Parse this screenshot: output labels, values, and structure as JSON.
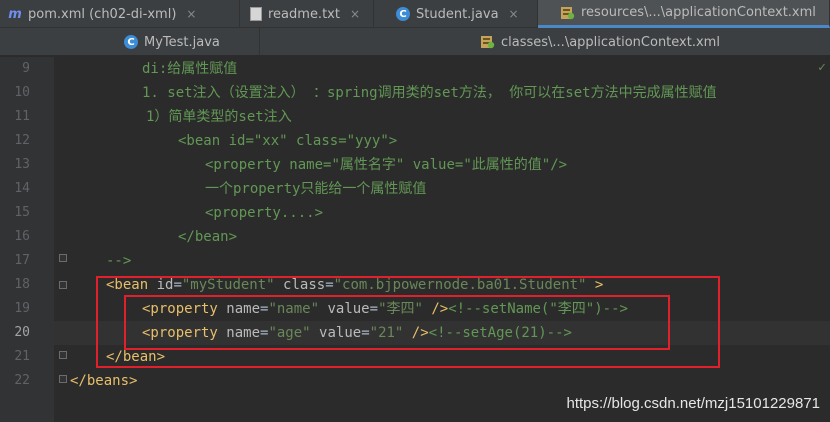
{
  "tabs_row1": [
    {
      "label": "pom.xml (ch02-di-xml)",
      "icon": "maven-icon"
    },
    {
      "label": "readme.txt",
      "icon": "text-file-icon"
    },
    {
      "label": "Student.java",
      "icon": "java-class-icon"
    },
    {
      "label": "resources\\...\\applicationContext.xml",
      "icon": "spring-xml-icon",
      "active": true
    }
  ],
  "tabs_row2": [
    {
      "label": "MyTest.java",
      "icon": "java-class-icon"
    },
    {
      "label": "classes\\...\\applicationContext.xml",
      "icon": "spring-xml-icon"
    }
  ],
  "close_glyph": "×",
  "line_numbers": [
    "9",
    "10",
    "11",
    "12",
    "13",
    "14",
    "15",
    "16",
    "17",
    "18",
    "19",
    "20",
    "21",
    "22"
  ],
  "current_line": "20",
  "lines": {
    "l9": {
      "text": "di:给属性赋值"
    },
    "l10": {
      "text": "1. set注入（设置注入） ：spring调用类的set方法， 你可以在set方法中完成属性赋值"
    },
    "l11": {
      "text": "1）简单类型的set注入"
    },
    "l12": {
      "t1": "<bean ",
      "a1": "id",
      "e1": "=",
      "v1": "\"xx\"",
      "s1": " ",
      "a2": "class",
      "e2": "=",
      "v2": "\"yyy\"",
      "t2": ">"
    },
    "l13": {
      "t1": "<property ",
      "a1": "name",
      "e1": "=",
      "v1": "\"属性名字\"",
      "s1": " ",
      "a2": "value",
      "e2": "=",
      "v2": "\"此属性的值\"",
      "t2": "/>"
    },
    "l14": {
      "text": "一个property只能给一个属性赋值"
    },
    "l15": {
      "text": "<property....>"
    },
    "l16": {
      "text": "</bean>"
    },
    "l17": {
      "text": "-->"
    },
    "l18": {
      "t1": "<bean ",
      "a1": "id",
      "e1": "=",
      "v1": "\"myStudent\"",
      "s1": " ",
      "a2": "class",
      "e2": "=",
      "v2": "\"com.bjpowernode.ba01.Student\"",
      "t2": " >"
    },
    "l19": {
      "t1": "<property ",
      "a1": "name",
      "e1": "=",
      "v1": "\"name\"",
      "s1": " ",
      "a2": "value",
      "e2": "=",
      "v2": "\"李四\"",
      "t2": " />",
      "cm": "<!--setName(\"李四\")-->"
    },
    "l20": {
      "t1": "<property ",
      "a1": "name",
      "e1": "=",
      "v1": "\"age\"",
      "s1": " ",
      "a2": "value",
      "e2": "=",
      "v2": "\"21\"",
      "t2": " />",
      "cm": "<!--setAge(21)-->"
    },
    "l21": {
      "text": "</bean>"
    },
    "l22": {
      "text": "</beans>"
    }
  },
  "watermark": "https://blog.csdn.net/mzj15101229871",
  "colors": {
    "tag": "#e8bf6a",
    "attr": "#bababa",
    "value": "#6a8759",
    "comment": "#629755",
    "highlight_box": "#e0202a"
  }
}
